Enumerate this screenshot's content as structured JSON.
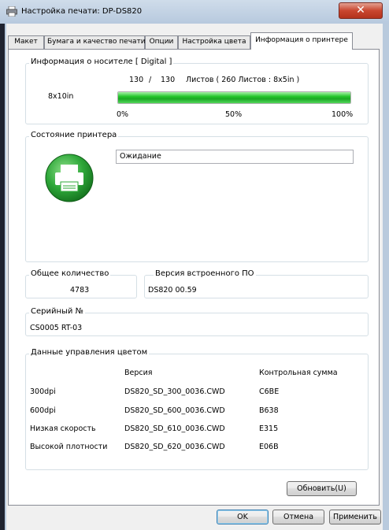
{
  "window": {
    "title": "Настройка печати: DP-DS820",
    "close_glyph": "✕"
  },
  "tabs": [
    {
      "label": "Макет"
    },
    {
      "label": "Бумага и качество печати"
    },
    {
      "label": "Опции"
    },
    {
      "label": "Настройка цвета"
    },
    {
      "label": "Информация о принтере",
      "active": true
    }
  ],
  "media": {
    "group_label": "Информация о носителе [ Digital ]",
    "remaining": "130",
    "sep": "/",
    "total": "130",
    "sheets_text": "Листов ( 260 Листов : 8x5in )",
    "size": "8x10in",
    "progress_fraction": 1.0,
    "scale": [
      "0%",
      "50%",
      "100%"
    ]
  },
  "printer_state": {
    "group_label": "Состояние принтера",
    "status": "Ожидание",
    "icon": "printer-ready-icon"
  },
  "total_count": {
    "group_label": "Общее количество",
    "value": "4783"
  },
  "firmware": {
    "group_label": "Версия встроенного ПО",
    "value": "DS820 00.59"
  },
  "serial": {
    "group_label": "Серийный №",
    "value": "CS0005 RT-03"
  },
  "color_mgmt": {
    "group_label": "Данные управления цветом",
    "headers": [
      "",
      "Версия",
      "Контрольная сумма"
    ],
    "rows": [
      [
        "300dpi",
        "DS820_SD_300_0036.CWD",
        "C6BE"
      ],
      [
        "600dpi",
        "DS820_SD_600_0036.CWD",
        "B638"
      ],
      [
        "Низкая скорость",
        "DS820_SD_610_0036.CWD",
        "E315"
      ],
      [
        "Высокой плотности",
        "DS820_SD_620_0036.CWD",
        "E06B"
      ]
    ]
  },
  "buttons": {
    "refresh": "Обновить(U)",
    "ok": "OK",
    "cancel": "Отмена",
    "apply": "Применить"
  },
  "colors": {
    "progress_green": "#1aa824",
    "close_red": "#c9462f",
    "printer_icon_green": "#2fa83a"
  }
}
